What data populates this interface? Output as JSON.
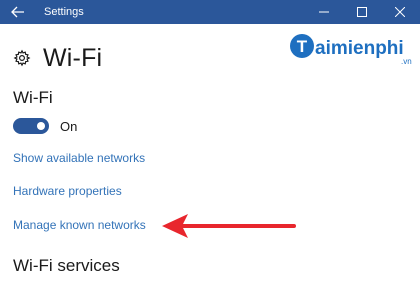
{
  "window": {
    "title": "Settings",
    "accent_color": "#2b579a",
    "controls": {
      "back_icon": "arrow-left-icon",
      "minimize_icon": "minimize-icon",
      "maximize_icon": "maximize-icon",
      "close_icon": "close-icon"
    }
  },
  "page": {
    "icon": "gear-icon",
    "title": "Wi-Fi"
  },
  "wifi": {
    "section_title": "Wi-Fi",
    "toggle_state": "On",
    "toggle_on": true
  },
  "links": {
    "show_networks": "Show available networks",
    "hardware_properties": "Hardware properties",
    "manage_networks": "Manage known networks",
    "link_color": "#3373b8"
  },
  "services": {
    "title": "Wi-Fi services"
  },
  "annotation": {
    "arrow_color": "#e8262d",
    "points_to": "Manage known networks"
  },
  "watermark": {
    "logo_text": "aimienphi",
    "logo_suffix": ".vn",
    "logo_color": "#1e6fc0"
  }
}
